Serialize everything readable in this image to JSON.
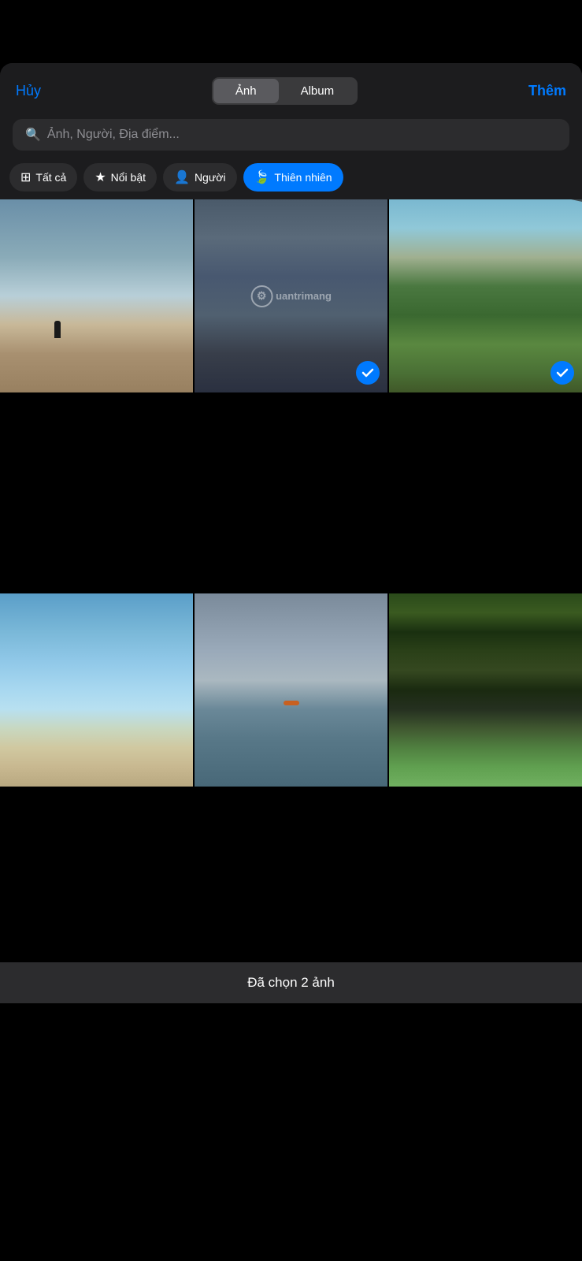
{
  "header": {
    "cancel_label": "Hủy",
    "add_label": "Thêm",
    "segment": {
      "tab1": "Ảnh",
      "tab2": "Album",
      "active": "tab1"
    }
  },
  "search": {
    "placeholder": "Ảnh, Người, Địa điểm..."
  },
  "filters": [
    {
      "id": "all",
      "label": "Tất cả",
      "icon": "grid",
      "active": false
    },
    {
      "id": "featured",
      "label": "Nổi bật",
      "icon": "star",
      "active": false
    },
    {
      "id": "people",
      "label": "Người",
      "icon": "person",
      "active": false
    },
    {
      "id": "nature",
      "label": "Thiên nhiên",
      "icon": "leaf",
      "active": true
    }
  ],
  "watermark": {
    "symbol": "⚙",
    "text": "uantrimang"
  },
  "photos": [
    {
      "id": 1,
      "selected": false,
      "class": "photo-1",
      "has_person": true,
      "has_cable": false
    },
    {
      "id": 2,
      "selected": true,
      "class": "photo-2",
      "has_person": false,
      "has_cable": false
    },
    {
      "id": 3,
      "selected": true,
      "class": "photo-3",
      "has_person": false,
      "has_cable": true
    },
    {
      "id": 4,
      "selected": false,
      "class": "photo-4",
      "has_person": false,
      "has_cable": false
    },
    {
      "id": 5,
      "selected": false,
      "class": "photo-5",
      "has_person": false,
      "has_cable": false
    },
    {
      "id": 6,
      "selected": false,
      "class": "photo-6",
      "has_person": false,
      "has_cable": false
    }
  ],
  "bottom_bar": {
    "selected_count": 2,
    "label": "Đã chọn 2 ảnh"
  }
}
